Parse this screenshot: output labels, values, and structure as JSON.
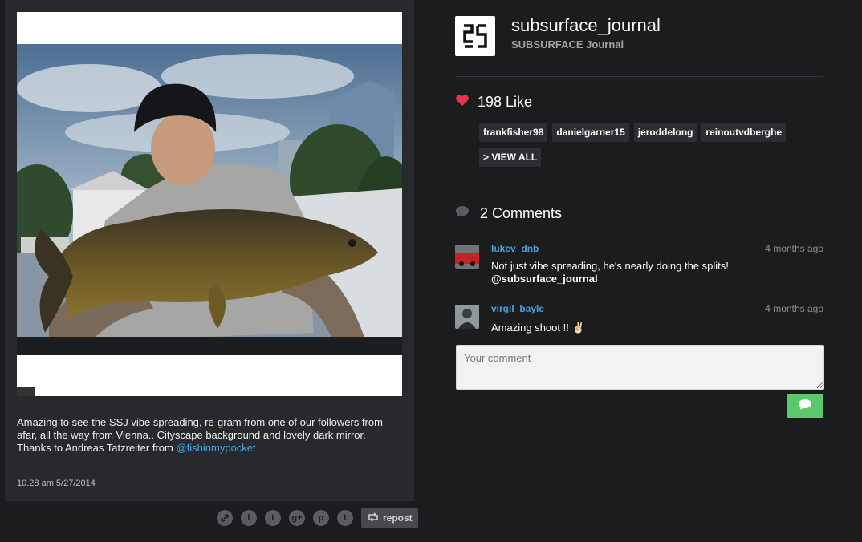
{
  "post": {
    "caption_text": "Amazing to see the SSJ vibe spreading, re-gram from one of our followers from afar, all the way from Vienna.. Cityscape background and lovely dark mirror. Thanks to Andreas Tatzreiter from ",
    "caption_mention": "@fishinmypocket",
    "timestamp": "10.28 am 5/27/2014",
    "photo_icon": "carp-angler-photo"
  },
  "share": {
    "icons": [
      "link-icon",
      "facebook-icon",
      "twitter-icon",
      "google-plus-icon",
      "pinterest-icon",
      "tumblr-icon"
    ],
    "glyphs": [
      "⛓",
      "f",
      "t",
      "g+",
      "p",
      "t"
    ],
    "repost_label": "repost"
  },
  "profile": {
    "username": "subsurface_journal",
    "fullname": "SUBSURFACE Journal",
    "logo_text": "2S"
  },
  "likes": {
    "count_label": "198 Like",
    "users": [
      "frankfisher98",
      "danielgarner15",
      "jeroddelong",
      "reinoutvdberghe"
    ],
    "view_all_label": "> VIEW ALL"
  },
  "comments": {
    "title": "2 Comments",
    "items": [
      {
        "user": "lukev_dnb",
        "time": "4 months ago",
        "text": "Not just vibe spreading, he's nearly doing the splits!",
        "mention": "@subsurface_journal"
      },
      {
        "user": "virgil_bayle",
        "time": "4 months ago",
        "text": "Amazing shoot !! ✌🏻",
        "mention": ""
      }
    ],
    "input_placeholder": "Your comment"
  },
  "colors": {
    "background": "#1b1c1e",
    "card": "#27292c",
    "accent_link": "#4aa3df",
    "heart": "#e8334f",
    "send": "#5cc86e"
  }
}
